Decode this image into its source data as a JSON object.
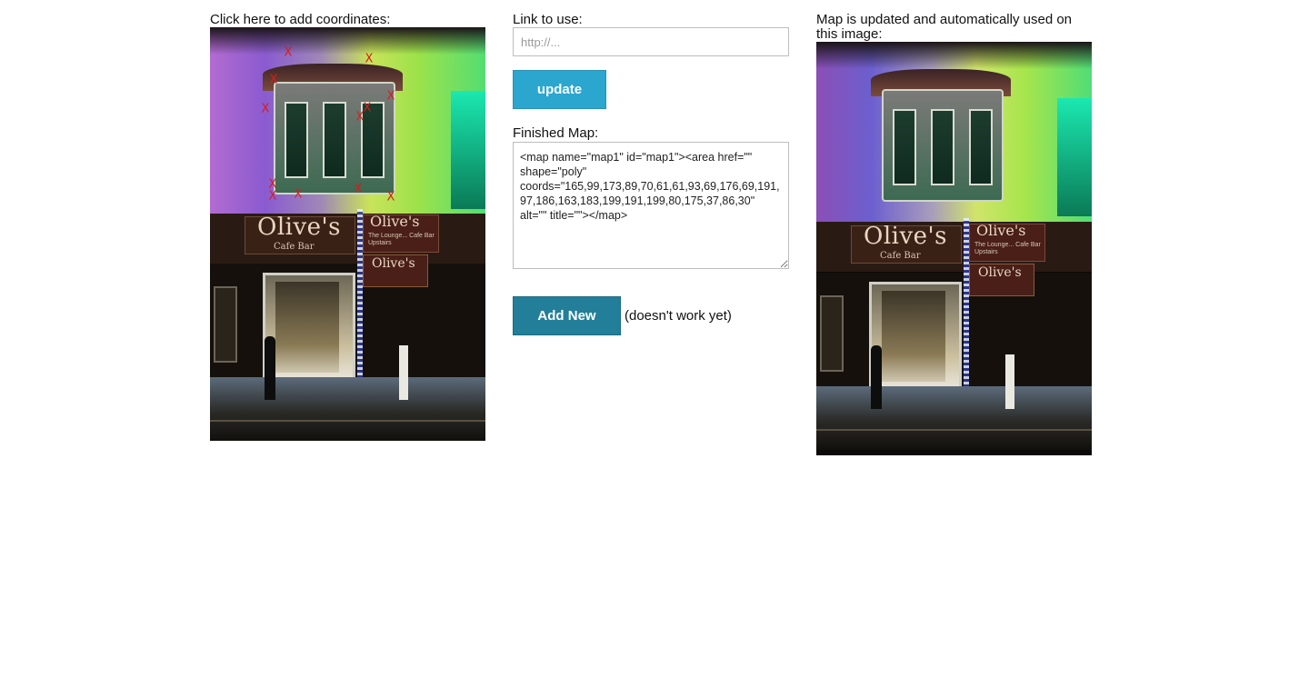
{
  "left": {
    "label": "Click here to add coordinates:",
    "marker_glyph": "X",
    "marker_color": "#d81c1c",
    "marker_count": 14
  },
  "middle": {
    "link_label": "Link to use:",
    "link_value": "",
    "link_placeholder": "http://...",
    "update_label": "update",
    "finished_label": "Finished Map:",
    "map_code": "<map name=\"map1\" id=\"map1\"><area href=\"\" shape=\"poly\" coords=\"165,99,173,89,70,61,61,93,69,176,69,191,97,186,163,183,199,191,199,80,175,37,86,30\" alt=\"\" title=\"\"></map>",
    "add_new_label": "Add New",
    "add_new_note": "(doesn't work yet)"
  },
  "right": {
    "label": "Map is updated and automatically used on this image:"
  },
  "photo": {
    "sign_main": "Olive's",
    "sign_main_sub": "Cafe Bar",
    "sign_right": "Olive's",
    "sign_right_sub": "The Lounge... Cafe Bar Upstairs",
    "hang_sign": "Olive's"
  },
  "colors": {
    "update_button": "#2ba6cf",
    "add_new_button": "#237f99"
  }
}
